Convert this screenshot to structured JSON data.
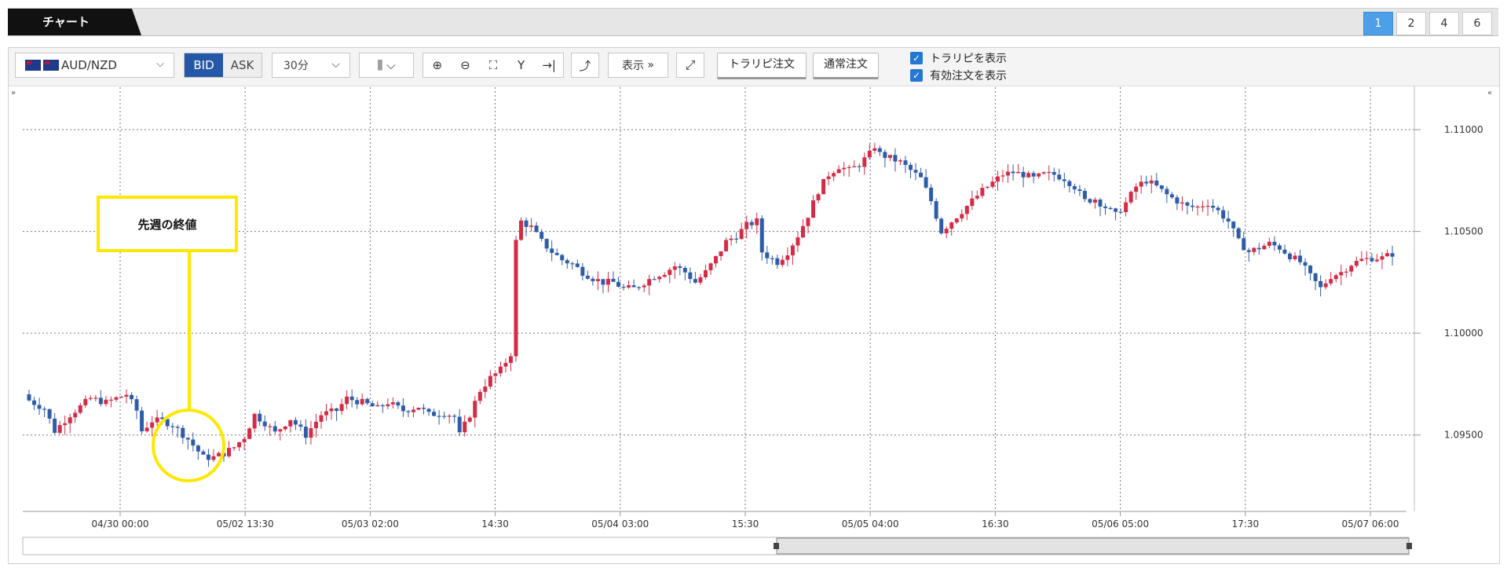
{
  "header": {
    "title": "チャート",
    "layouts": [
      "1",
      "2",
      "4",
      "6"
    ],
    "active_layout": "1"
  },
  "toolbar": {
    "symbol": "AUD/NZD",
    "bid_label": "BID",
    "ask_label": "ASK",
    "interval": "30分",
    "display_label": "表示",
    "trap_button": "トラリピ注文",
    "normal_button": "通常注文",
    "check_trap": "トラリピを表示",
    "check_orders": "有効注文を表示"
  },
  "icons": {
    "expand_left": "»",
    "expand_right": "«"
  },
  "annotation": {
    "text": "先週の終値"
  },
  "colors": {
    "up": "#d42b46",
    "down": "#2f5ca8",
    "highlight": "#ffe800"
  },
  "chart_data": {
    "type": "candlestick",
    "pair": "AUD/NZD",
    "interval": "30分",
    "y_ticks": [
      "1.11000",
      "1.10500",
      "1.10000",
      "1.09500"
    ],
    "ylim": [
      1.0914,
      1.1117
    ],
    "x_ticks": [
      "04/30 00:00",
      "05/02 13:30",
      "05/03 02:00",
      "14:30",
      "05/04 03:00",
      "15:30",
      "05/05 04:00",
      "16:30",
      "05/06 05:00",
      "17:30",
      "05/07 06:00"
    ],
    "grid": true,
    "close_path": [
      [
        0,
        1.0967
      ],
      [
        3,
        1.0963
      ],
      [
        5,
        1.0952
      ],
      [
        8,
        1.096
      ],
      [
        12,
        1.0968
      ],
      [
        15,
        1.0966
      ],
      [
        19,
        1.097
      ],
      [
        21,
        1.0962
      ],
      [
        22,
        1.0952
      ],
      [
        24,
        1.0957
      ],
      [
        26,
        1.0957
      ],
      [
        28,
        1.0955
      ],
      [
        31,
        1.0948
      ],
      [
        34,
        1.0939
      ],
      [
        36,
        1.0939
      ],
      [
        38,
        1.0941
      ],
      [
        40,
        1.0944
      ],
      [
        42,
        1.0949
      ],
      [
        44,
        1.096
      ],
      [
        46,
        1.0956
      ],
      [
        48,
        1.0951
      ],
      [
        51,
        1.0958
      ],
      [
        54,
        1.095
      ],
      [
        57,
        1.096
      ],
      [
        60,
        1.0962
      ],
      [
        62,
        1.0968
      ],
      [
        65,
        1.0966
      ],
      [
        68,
        1.0963
      ],
      [
        70,
        1.0966
      ],
      [
        73,
        1.0962
      ],
      [
        76,
        1.0964
      ],
      [
        78,
        1.096
      ],
      [
        81,
        1.0961
      ],
      [
        83,
        1.0959
      ],
      [
        84,
        1.095
      ],
      [
        86,
        1.096
      ],
      [
        88,
        1.0972
      ],
      [
        90,
        1.0978
      ],
      [
        92,
        1.0982
      ],
      [
        94,
        1.099
      ],
      [
        95,
        1.1045
      ],
      [
        96,
        1.1055
      ],
      [
        98,
        1.1052
      ],
      [
        100,
        1.1045
      ],
      [
        102,
        1.104
      ],
      [
        104,
        1.1036
      ],
      [
        106,
        1.1034
      ],
      [
        108,
        1.103
      ],
      [
        110,
        1.1027
      ],
      [
        112,
        1.1025
      ],
      [
        114,
        1.1025
      ],
      [
        116,
        1.1022
      ],
      [
        118,
        1.1022
      ],
      [
        120,
        1.1025
      ],
      [
        122,
        1.1028
      ],
      [
        124,
        1.103
      ],
      [
        126,
        1.1033
      ],
      [
        128,
        1.103
      ],
      [
        130,
        1.1025
      ],
      [
        132,
        1.103
      ],
      [
        134,
        1.1037
      ],
      [
        136,
        1.1045
      ],
      [
        138,
        1.1048
      ],
      [
        140,
        1.1053
      ],
      [
        142,
        1.1055
      ],
      [
        143,
        1.104
      ],
      [
        144,
        1.1038
      ],
      [
        146,
        1.1035
      ],
      [
        148,
        1.104
      ],
      [
        150,
        1.1048
      ],
      [
        152,
        1.1058
      ],
      [
        154,
        1.107
      ],
      [
        156,
        1.1078
      ],
      [
        158,
        1.1082
      ],
      [
        160,
        1.108
      ],
      [
        162,
        1.1083
      ],
      [
        164,
        1.1088
      ],
      [
        165,
        1.1092
      ],
      [
        166,
        1.1088
      ],
      [
        168,
        1.1086
      ],
      [
        170,
        1.1084
      ],
      [
        172,
        1.108
      ],
      [
        174,
        1.1076
      ],
      [
        176,
        1.1065
      ],
      [
        178,
        1.105
      ],
      [
        180,
        1.1055
      ],
      [
        182,
        1.106
      ],
      [
        184,
        1.1065
      ],
      [
        186,
        1.107
      ],
      [
        188,
        1.1074
      ],
      [
        190,
        1.1078
      ],
      [
        192,
        1.1079
      ],
      [
        194,
        1.1078
      ],
      [
        196,
        1.1076
      ],
      [
        198,
        1.1078
      ],
      [
        200,
        1.1078
      ],
      [
        202,
        1.1076
      ],
      [
        204,
        1.1072
      ],
      [
        206,
        1.1065
      ],
      [
        208,
        1.1066
      ],
      [
        210,
        1.1062
      ],
      [
        212,
        1.1058
      ],
      [
        214,
        1.1064
      ],
      [
        216,
        1.1072
      ],
      [
        218,
        1.1075
      ],
      [
        220,
        1.1072
      ],
      [
        222,
        1.1068
      ],
      [
        224,
        1.1065
      ],
      [
        226,
        1.1062
      ],
      [
        228,
        1.1062
      ],
      [
        230,
        1.1064
      ],
      [
        232,
        1.106
      ],
      [
        234,
        1.1055
      ],
      [
        236,
        1.1045
      ],
      [
        238,
        1.104
      ],
      [
        240,
        1.1042
      ],
      [
        242,
        1.1044
      ],
      [
        244,
        1.1042
      ],
      [
        246,
        1.1038
      ],
      [
        248,
        1.1035
      ],
      [
        250,
        1.1028
      ],
      [
        252,
        1.1022
      ],
      [
        254,
        1.1028
      ],
      [
        256,
        1.103
      ],
      [
        258,
        1.1034
      ],
      [
        260,
        1.1036
      ],
      [
        262,
        1.1037
      ],
      [
        264,
        1.1037
      ],
      [
        266,
        1.1039
      ]
    ]
  }
}
